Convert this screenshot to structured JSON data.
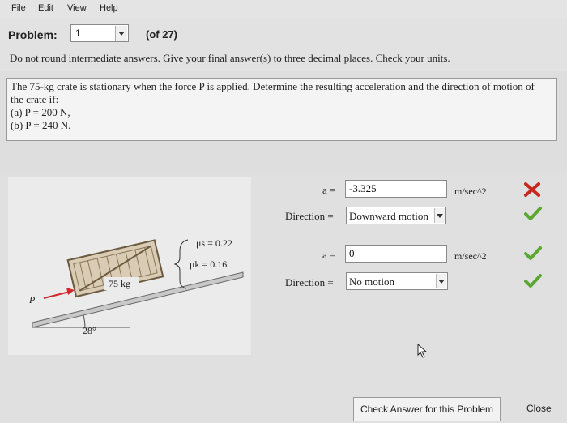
{
  "menu": {
    "file": "File",
    "edit": "Edit",
    "view": "View",
    "help": "Help"
  },
  "header": {
    "problem_label": "Problem:",
    "problem_number": "1",
    "of_total": "(of 27)",
    "instructions": "Do not round intermediate answers.  Give your final answer(s) to three decimal places.  Check your units."
  },
  "problem": {
    "line1": "The 75-kg crate is stationary when the force P is applied.  Determine the resulting acceleration and the direction of motion of",
    "line2": "the crate if:",
    "part_a": "(a) P = 200 N,",
    "part_b": "(b) P = 240 N."
  },
  "figure": {
    "mu_s": "μs = 0.22",
    "mu_k": "μk = 0.16",
    "mass": "75 kg",
    "force": "P",
    "angle": "28°"
  },
  "answers": [
    {
      "accel_label": "a =",
      "accel_value": "-3.325",
      "unit": "m/sec^2",
      "accel_status": "incorrect",
      "direction_label": "Direction =",
      "direction_value": "Downward motion",
      "direction_status": "correct"
    },
    {
      "accel_label": "a =",
      "accel_value": "0",
      "unit": "m/sec^2",
      "accel_status": "correct",
      "direction_label": "Direction =",
      "direction_value": "No motion",
      "direction_status": "correct"
    }
  ],
  "colors": {
    "correct": "#5aa832",
    "incorrect": "#c8281e",
    "force_arrow": "#d2282e"
  },
  "buttons": {
    "check": "Check Answer for this Problem",
    "close": "Close"
  }
}
